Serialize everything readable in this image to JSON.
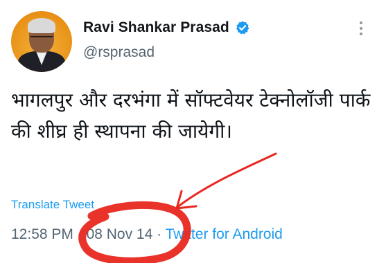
{
  "author": {
    "display_name": "Ravi Shankar Prasad",
    "handle": "@rsprasad",
    "verified_icon": "verified-badge-icon",
    "avatar_icon": "profile-avatar"
  },
  "tweet": {
    "text": "भागलपुर और दरभंगा में सॉफ्टवेयर टेक्नोलॉजी पार्क की शीघ्र ही स्थापना की जायेगी।",
    "translate_label": "Translate Tweet",
    "time": "12:58 PM",
    "separator": " · ",
    "date": "08 Nov 14",
    "source": "Twitter for Android"
  },
  "more_icon": "more-options-icon",
  "colors": {
    "accent": "#1d9bf0",
    "secondary_text": "#536471",
    "annotation": "#e8271f"
  }
}
